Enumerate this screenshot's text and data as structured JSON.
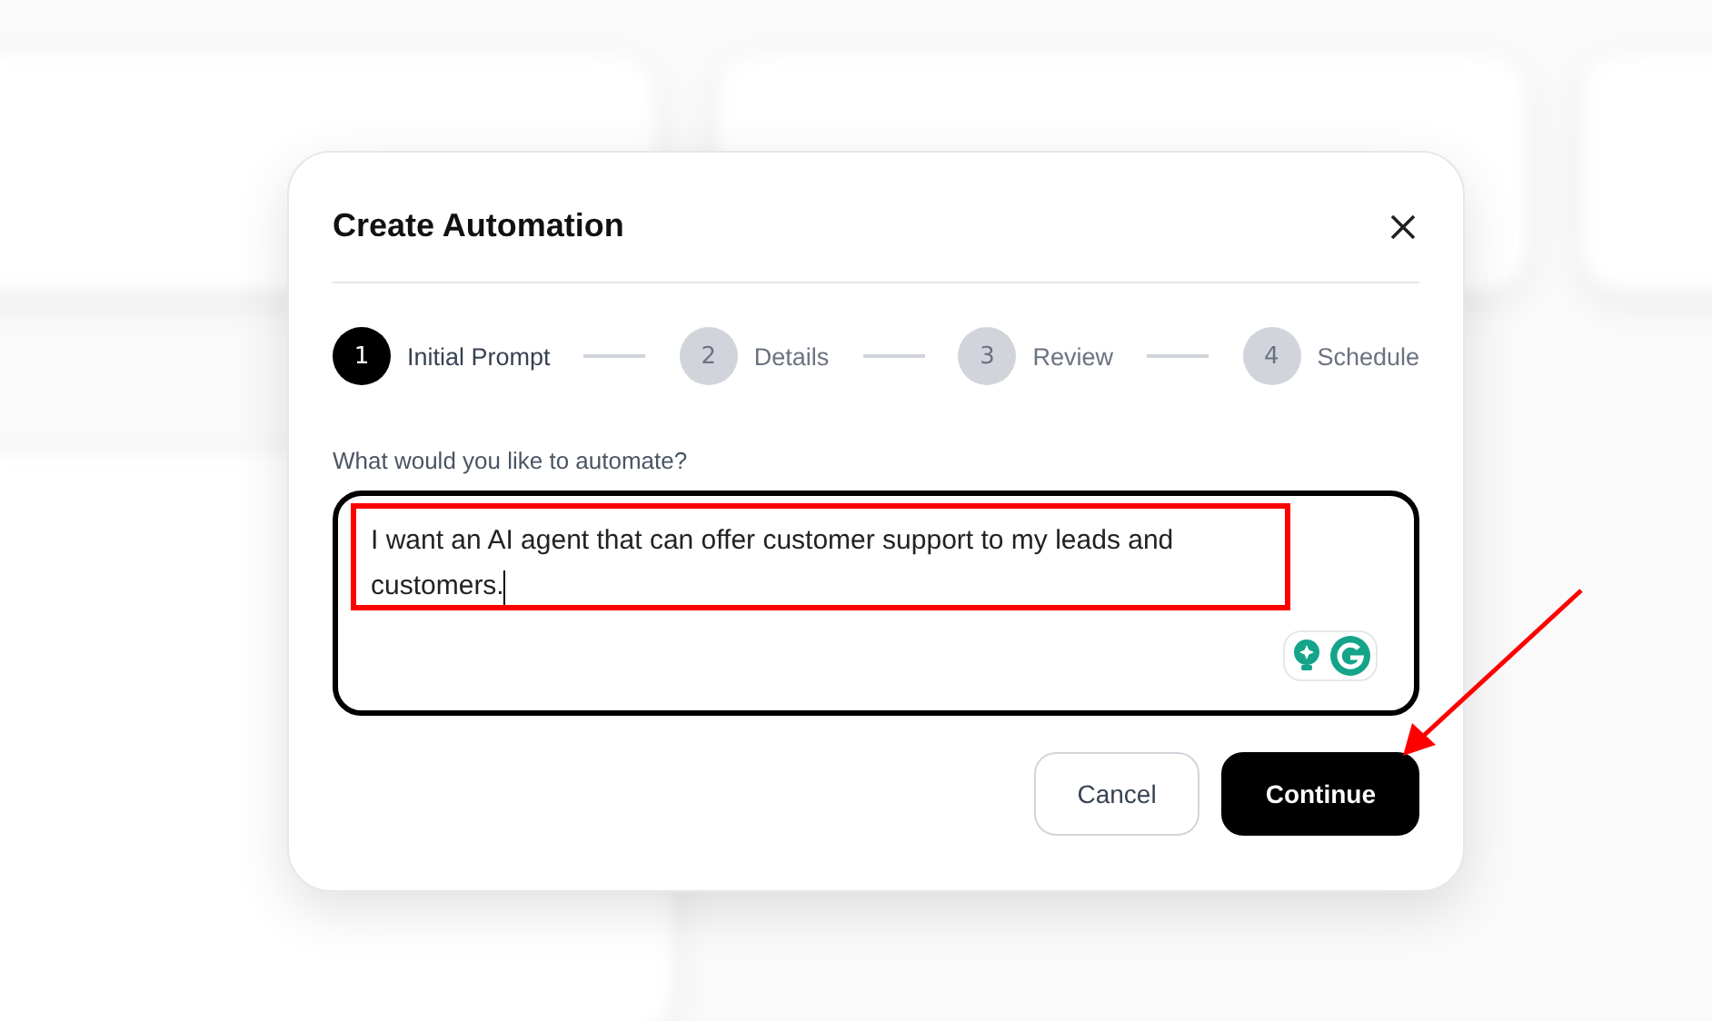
{
  "dialog": {
    "title": "Create Automation",
    "steps": [
      {
        "number": "1",
        "label": "Initial Prompt",
        "selected": true
      },
      {
        "number": "2",
        "label": "Details",
        "selected": false
      },
      {
        "number": "3",
        "label": "Review",
        "selected": false
      },
      {
        "number": "4",
        "label": "Schedule",
        "selected": false
      }
    ],
    "prompt": {
      "label": "What would you like to automate?",
      "value": "I want an AI agent that can offer customer support to my leads and customers."
    },
    "buttons": [
      {
        "label": "Cancel",
        "kind": "secondary"
      },
      {
        "label": "Continue",
        "kind": "primary"
      }
    ]
  }
}
